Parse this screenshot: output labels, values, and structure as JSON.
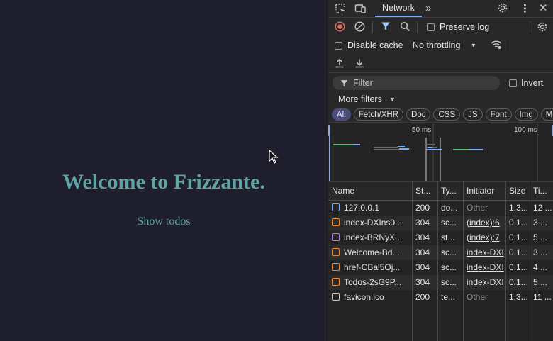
{
  "app": {
    "title": "Welcome to Frizzante.",
    "link": "Show todos"
  },
  "devtools": {
    "tab": "Network",
    "preserve_log": "Preserve log",
    "disable_cache": "Disable cache",
    "throttling": "No throttling",
    "filter_placeholder": "Filter",
    "invert": "Invert",
    "more_filters": "More filters",
    "type_filters": [
      "All",
      "Fetch/XHR",
      "Doc",
      "CSS",
      "JS",
      "Font",
      "Img",
      "Med"
    ],
    "timeline_ticks": [
      "50 ms",
      "100 ms"
    ],
    "columns": [
      "Name",
      "St...",
      "Ty...",
      "Initiator",
      "Size",
      "Ti..."
    ],
    "rows": [
      {
        "icon": "document-icon",
        "name": "127.0.0.1",
        "status": "200",
        "type": "do...",
        "initiator": "Other",
        "size": "1.3...",
        "time": "12 ..."
      },
      {
        "icon": "script-icon",
        "name": "index-DXIns0...",
        "status": "304",
        "type": "sc...",
        "initiator": "(index):6",
        "size": "0.1...",
        "time": "3 ..."
      },
      {
        "icon": "stylesheet-icon",
        "name": "index-BRNyX...",
        "status": "304",
        "type": "st...",
        "initiator": "(index):7",
        "size": "0.1...",
        "time": "5 ..."
      },
      {
        "icon": "script-icon",
        "name": "Welcome-Bd...",
        "status": "304",
        "type": "sc...",
        "initiator": "index-DXI",
        "size": "0.1...",
        "time": "3 ..."
      },
      {
        "icon": "script-icon",
        "name": "href-CBal5Oj...",
        "status": "304",
        "type": "sc...",
        "initiator": "index-DXI",
        "size": "0.1...",
        "time": "4 ..."
      },
      {
        "icon": "script-icon",
        "name": "Todos-2sG9P...",
        "status": "304",
        "type": "sc...",
        "initiator": "index-DXI",
        "size": "0.1...",
        "time": "5 ..."
      },
      {
        "icon": "file-icon",
        "name": "favicon.ico",
        "status": "200",
        "type": "te...",
        "initiator": "Other",
        "size": "1.3...",
        "time": "11 ..."
      }
    ]
  },
  "colors": {
    "app_bg": "#1e1e2d",
    "app_accent": "#5fa3a5",
    "devtools_bg": "#282828",
    "record_red": "#e46962",
    "filter_blue": "#7cacf8",
    "script_icon": "#e8883b",
    "stylesheet_icon": "#b27fe0",
    "document_icon": "#7cacf8"
  }
}
